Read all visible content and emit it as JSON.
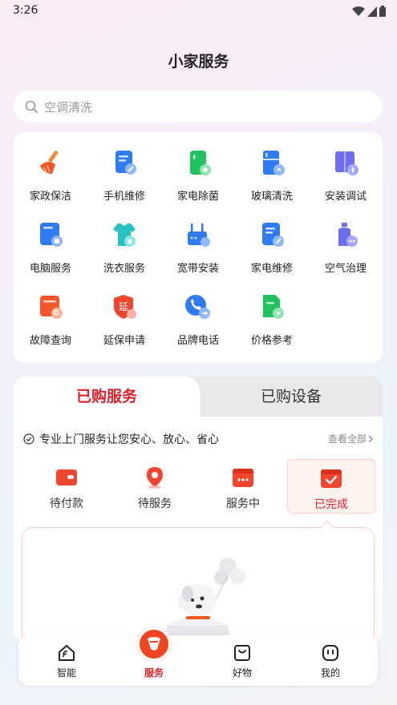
{
  "status_bar": {
    "time": "3:26"
  },
  "header": {
    "title": "小家服务"
  },
  "search": {
    "placeholder": "空调清洗"
  },
  "services": [
    {
      "label": "家政保洁",
      "icon": "broom-icon"
    },
    {
      "label": "手机维修",
      "icon": "phone-repair-icon"
    },
    {
      "label": "家电除菌",
      "icon": "appliance-sterilize-icon"
    },
    {
      "label": "玻璃清洗",
      "icon": "glass-clean-icon"
    },
    {
      "label": "安装调试",
      "icon": "install-icon"
    },
    {
      "label": "电脑服务",
      "icon": "computer-icon"
    },
    {
      "label": "洗衣服务",
      "icon": "laundry-icon"
    },
    {
      "label": "宽带安装",
      "icon": "router-icon"
    },
    {
      "label": "家电维修",
      "icon": "appliance-repair-icon"
    },
    {
      "label": "空气治理",
      "icon": "air-spray-icon"
    },
    {
      "label": "故障查询",
      "icon": "fault-query-icon"
    },
    {
      "label": "延保申请",
      "icon": "warranty-icon"
    },
    {
      "label": "品牌电话",
      "icon": "brand-phone-icon"
    },
    {
      "label": "价格参考",
      "icon": "price-reference-icon"
    }
  ],
  "purchased": {
    "tabs": [
      "已购服务",
      "已购设备"
    ],
    "promise_text": "专业上门服务让您安心、放心、省心",
    "view_all": "查看全部",
    "statuses": [
      {
        "label": "待付款",
        "icon": "wallet-icon"
      },
      {
        "label": "待服务",
        "icon": "location-pin-icon"
      },
      {
        "label": "服务中",
        "icon": "in-progress-icon"
      },
      {
        "label": "已完成",
        "icon": "completed-icon"
      }
    ]
  },
  "bottom_nav": [
    {
      "label": "智能",
      "icon": "smart-home-icon"
    },
    {
      "label": "服务",
      "icon": "service-icon"
    },
    {
      "label": "好物",
      "icon": "shopping-icon"
    },
    {
      "label": "我的",
      "icon": "profile-icon"
    }
  ],
  "colors": {
    "accent": "#e3202a",
    "orange": "#f0451e",
    "blue": "#2f7bf5"
  }
}
